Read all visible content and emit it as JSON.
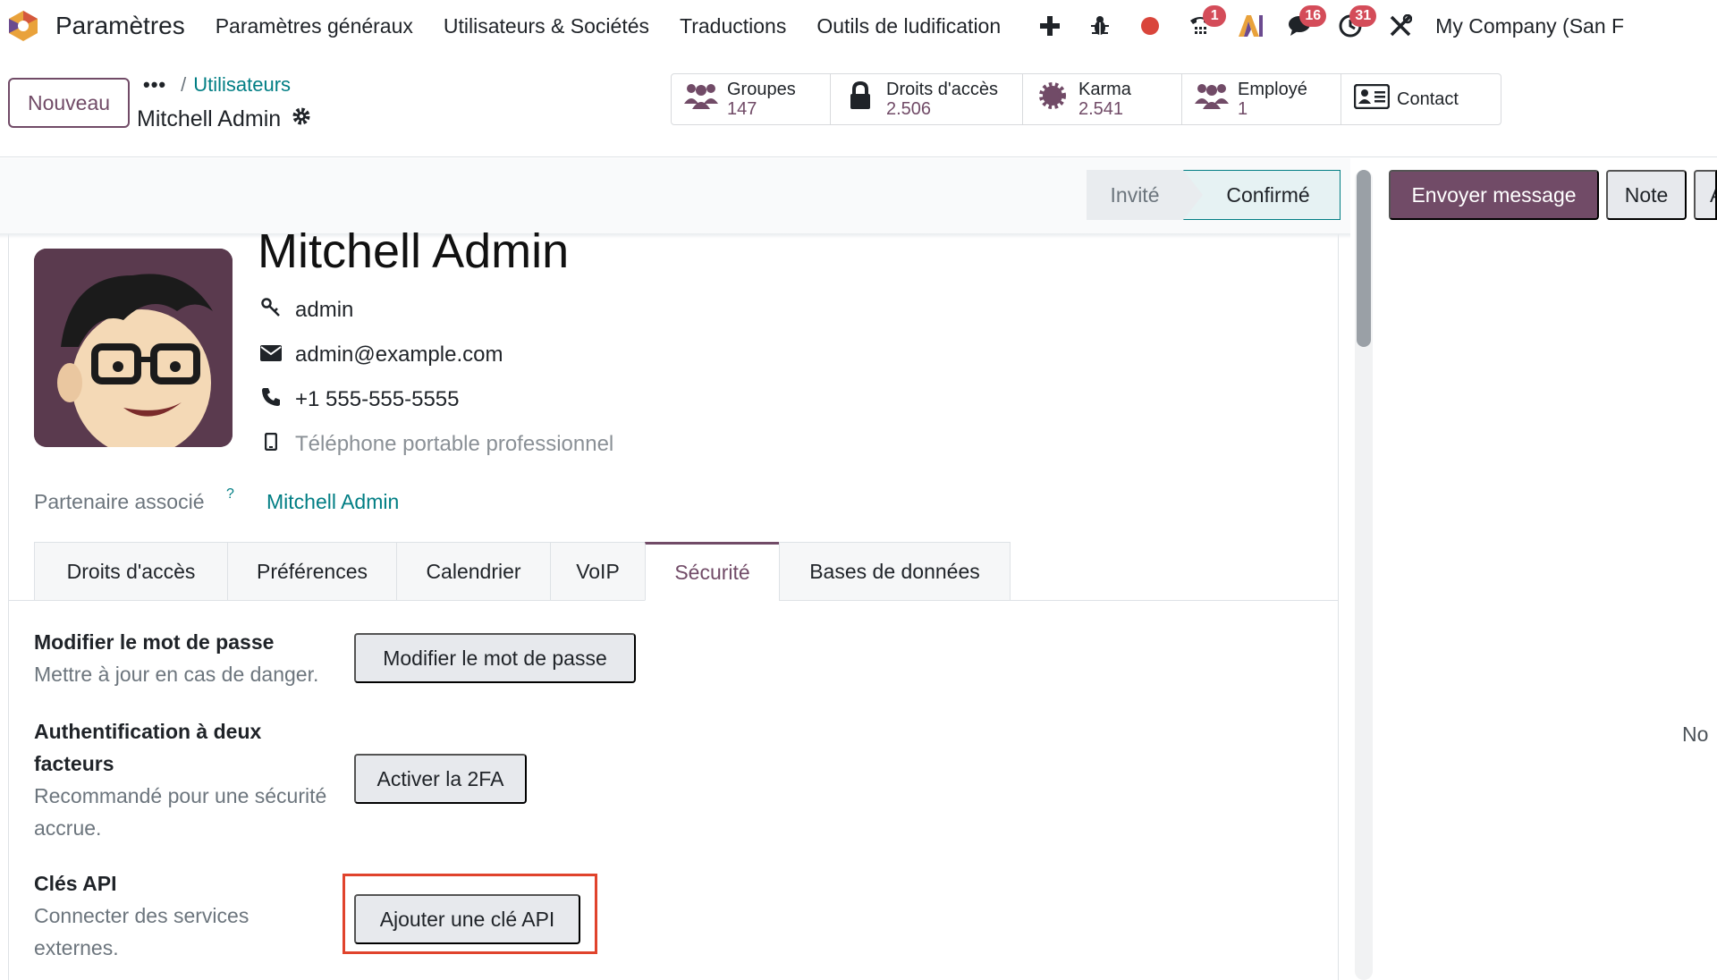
{
  "navbar": {
    "app_title": "Paramètres",
    "menu": [
      "Paramètres généraux",
      "Utilisateurs & Sociétés",
      "Traductions",
      "Outils de ludification"
    ],
    "badges": {
      "voip": "1",
      "messages": "16",
      "activities": "31"
    },
    "company": "My Company (San F"
  },
  "control": {
    "new_button": "Nouveau",
    "breadcrumb_ellipsis": "•••",
    "breadcrumb_sep": "/",
    "breadcrumb_parent": "Utilisateurs",
    "record_title": "Mitchell Admin"
  },
  "smart_buttons": [
    {
      "label": "Groupes",
      "value": "147",
      "icon": "users-icon"
    },
    {
      "label": "Droits d'accès",
      "value": "2.506",
      "icon": "lock-icon"
    },
    {
      "label": "Karma",
      "value": "2.541",
      "icon": "badge-icon"
    },
    {
      "label": "Employé",
      "value": "1",
      "icon": "users-icon"
    },
    {
      "label": "Contact",
      "icon": "contact-card-icon"
    }
  ],
  "status": {
    "stages": [
      "Invité",
      "Confirmé"
    ],
    "active": "Confirmé"
  },
  "user": {
    "name": "Mitchell Admin",
    "login": "admin",
    "email": "admin@example.com",
    "phone": "+1 555-555-5555",
    "mobile_placeholder": "Téléphone portable professionnel",
    "partner_label": "Partenaire associé",
    "partner_help": "?",
    "partner_value": "Mitchell Admin"
  },
  "tabs": [
    {
      "label": "Droits d'accès"
    },
    {
      "label": "Préférences"
    },
    {
      "label": "Calendrier"
    },
    {
      "label": "VoIP"
    },
    {
      "label": "Sécurité",
      "active": true
    },
    {
      "label": "Bases de données"
    }
  ],
  "security": {
    "password": {
      "title": "Modifier le mot de passe",
      "desc": "Mettre à jour en cas de danger.",
      "button": "Modifier le mot de passe"
    },
    "twofa": {
      "title_line1": "Authentification à deux",
      "title_line2": "facteurs",
      "desc_line1": "Recommandé pour une sécurité",
      "desc_line2": "accrue.",
      "button": "Activer la 2FA"
    },
    "api": {
      "title": "Clés API",
      "desc_line1": "Connecter des services",
      "desc_line2": "externes.",
      "button": "Ajouter une clé API"
    }
  },
  "chatter": {
    "send_button": "Envoyer message",
    "note_button": "Note",
    "activity_button": "Activités",
    "empty_text": "No"
  },
  "colors": {
    "primary": "#714b67",
    "link": "#017e84",
    "badge": "#d44c59",
    "highlight": "#e0432c"
  }
}
